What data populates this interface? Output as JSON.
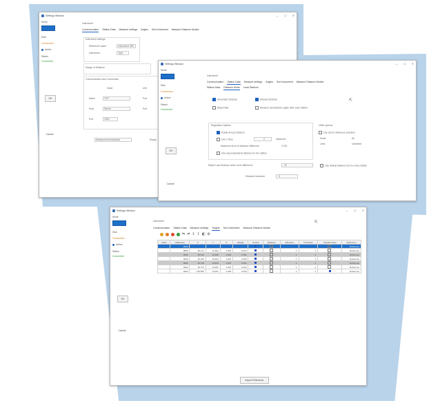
{
  "app": {
    "title": "Settings Window",
    "win_controls": [
      "—",
      "☐",
      "✕"
    ]
  },
  "left_panel": {
    "mode_label": "Mode",
    "combo_value": "",
    "items": [
      {
        "label": "Disk",
        "style": "plain"
      },
      {
        "label": "Connection",
        "style": "orange"
      },
      {
        "label": "Active",
        "style": "dot"
      }
    ],
    "status_label": "Status",
    "status_value": "Connected",
    "ok_label": "OK",
    "cancel_label": "Cancel"
  },
  "win1": {
    "section": "Instrument",
    "tabs": [
      "Communication",
      "Station Data",
      "Measure settings",
      "Angles",
      "Sort instrument",
      "Measure Distance Modes"
    ],
    "group1_title": "Instrument settings",
    "group1_rows": [
      {
        "label": "Reference name",
        "value": "Instrument 360"
      },
      {
        "label": "Instrument",
        "value": "Type"
      }
    ],
    "group2_title": "Range of Distance",
    "group3_title": "Communication and Connection",
    "group3_cols": [
      "Value",
      "Unit"
    ],
    "group3_rows": [
      {
        "label": "Name",
        "value": "TCP",
        "unit": "Port"
      },
      {
        "label": "Host",
        "value": "Server",
        "unit": "Port"
      },
      {
        "label": "Port",
        "value": "1000",
        "unit": ""
      }
    ],
    "bottom_label": "Measurement standard",
    "bottom_right": "Ready"
  },
  "win2": {
    "section": "Instrument",
    "tabs_row1": [
      "Communication",
      "Station Data",
      "Measure settings",
      "Angles",
      "Sort instrument",
      "Measure Distance Modes"
    ],
    "tabs_row2": [
      "Station Data",
      "Distance Mode",
      "Level Stations"
    ],
    "radio1": "Automatic Distance",
    "radio2": "Manual Distance",
    "check1": "Reject fails",
    "check2": "Measure all distances again after each station",
    "group_title": "Regulation Options",
    "g_opt1": "Rotate Every Distance",
    "g_opt2": "Use 2 fixes",
    "g_opt2_val": "2",
    "g_opt2_unit": "distances",
    "g_line3": "Maximum error to distance difference",
    "g_line3_val": "0.001",
    "g_opt4": "Use any (calculated) distance for the station",
    "right_title": "Other options",
    "right_opt1": "Use set for distances selection",
    "right_k1": "Mode",
    "right_v1": "All",
    "right_k2": "Limit",
    "right_v2": "Unlimited",
    "row_label": "Reject Last Distance when more difference",
    "row_value": "10",
    "row_check": "Use default distance set for every station",
    "sub_label": "Distance tolerance",
    "sub_value": "5"
  },
  "win3": {
    "section": "Instrument",
    "tabs": [
      "Communication",
      "Station Data",
      "Measure settings",
      "Targets",
      "Sort instrument",
      "Measure Distance Modes"
    ],
    "toolbar_icons": [
      {
        "name": "orange-circle-icon",
        "color": "#e0a020"
      },
      {
        "name": "orange-circle-icon",
        "color": "#e07c20"
      },
      {
        "name": "red-circle-icon",
        "color": "#d94a2a"
      },
      {
        "name": "green-circle-icon",
        "color": "#2e9e3e"
      }
    ],
    "toolbar_glyphs": [
      "⇆",
      "⇄",
      "↥",
      "↧",
      "◧",
      "⊞"
    ],
    "columns": [
      "Label",
      "Addresses",
      "X",
      "Y",
      "Z",
      "Heights",
      "Control",
      "Reflector",
      "Tolerance",
      "Correction",
      "Checked Sign",
      "Reference"
    ],
    "rows": [
      {
        "cells": [
          "",
          "0000",
          "",
          "",
          "",
          "",
          "",
          "",
          "",
          "",
          "",
          "Reference"
        ],
        "style": "sel"
      },
      {
        "cells": [
          "",
          "0000",
          "35.171",
          "17.452",
          "1.015",
          "3.215",
          "",
          "",
          "1",
          "1",
          "",
          "Reference"
        ],
        "style": "plain"
      },
      {
        "cells": [
          "",
          "0000",
          "35.416",
          "16.208",
          "1.044",
          "3.206",
          "",
          "",
          "1",
          "1",
          "",
          "Reference"
        ],
        "style": "gray"
      },
      {
        "cells": [
          "",
          "0000",
          "36.165",
          "15.920",
          "1.040",
          "3.208",
          "",
          "",
          "1",
          "1",
          "",
          "Reference"
        ],
        "style": "plain"
      },
      {
        "cells": [
          "",
          "0000",
          "36.718",
          "14.640",
          "1.037",
          "3.203",
          "",
          "",
          "1",
          "1",
          "",
          "Reference"
        ],
        "style": "gray"
      },
      {
        "cells": [
          "",
          "0000",
          "36.770",
          "13.387",
          "1.037",
          "3.204",
          "",
          "",
          "1",
          "1",
          "",
          "Reference"
        ],
        "style": "plain"
      },
      {
        "cells": [
          "",
          "0000",
          "135.555",
          "13.021",
          "1.038",
          "3.209",
          "",
          "",
          "1",
          "1",
          "",
          "Reference"
        ],
        "style": "plain"
      }
    ],
    "bottom_button": "Import Reference"
  },
  "colors": {
    "accent": "#1e6fc8",
    "backdrop": "#b9d3ea"
  }
}
